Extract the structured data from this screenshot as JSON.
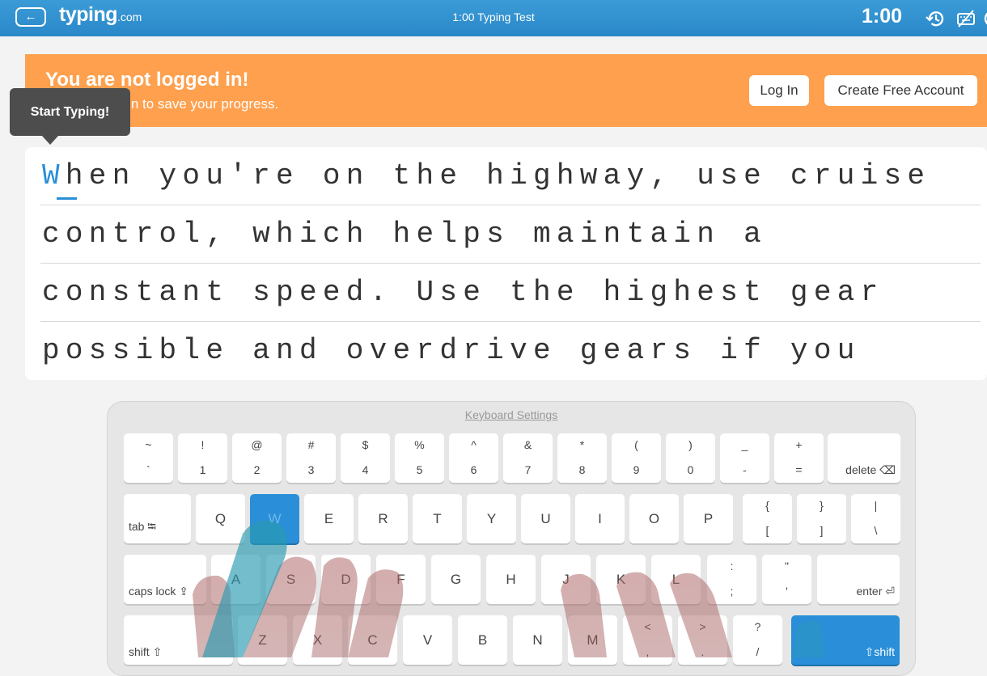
{
  "header": {
    "back_icon": "arrow-left-icon",
    "logo_main": "typing",
    "logo_domain": ".com",
    "title": "1:00 Typing Test",
    "timer": "1:00",
    "history_icon": "history-icon",
    "hide_keyboard_icon": "keyboard-off-icon",
    "colors": {
      "bar": "#2a88c9",
      "accent": "#2a8fd8"
    }
  },
  "banner": {
    "title": "You are not logged in!",
    "subtitle": "ccount or log in to save your progress.",
    "login_label": "Log In",
    "create_label": "Create Free Account",
    "color": "#fea04e"
  },
  "tooltip": {
    "text": "Start Typing!"
  },
  "text_panel": {
    "current_char": "W",
    "line1_rest": "hen you're on the highway, use cruise",
    "lines": [
      "control, which helps maintain a",
      "constant speed. Use the highest gear",
      "possible and overdrive gears if you"
    ]
  },
  "keyboard": {
    "settings_label": "Keyboard Settings",
    "row1": [
      {
        "top": "~",
        "bottom": "`"
      },
      {
        "top": "!",
        "bottom": "1"
      },
      {
        "top": "@",
        "bottom": "2"
      },
      {
        "top": "#",
        "bottom": "3"
      },
      {
        "top": "$",
        "bottom": "4"
      },
      {
        "top": "%",
        "bottom": "5"
      },
      {
        "top": "^",
        "bottom": "6"
      },
      {
        "top": "&",
        "bottom": "7"
      },
      {
        "top": "*",
        "bottom": "8"
      },
      {
        "top": "(",
        "bottom": "9"
      },
      {
        "top": ")",
        "bottom": "0"
      },
      {
        "top": "_",
        "bottom": "-"
      },
      {
        "top": "+",
        "bottom": "="
      }
    ],
    "delete_label": "delete ⌫",
    "tab_label": "tab ⭾",
    "row2": [
      "Q",
      "W",
      "E",
      "R",
      "T",
      "Y",
      "U",
      "I",
      "O",
      "P"
    ],
    "row2_symbols": [
      {
        "top": "{",
        "bottom": "["
      },
      {
        "top": "}",
        "bottom": "]"
      },
      {
        "top": "|",
        "bottom": "\\"
      }
    ],
    "caps_label": "caps lock ⇪",
    "row3": [
      "A",
      "S",
      "D",
      "F",
      "G",
      "H",
      "J",
      "K",
      "L"
    ],
    "row3_symbols": [
      {
        "top": ":",
        "bottom": ";"
      },
      {
        "top": "\"",
        "bottom": "'"
      }
    ],
    "enter_label": "enter ⏎",
    "shift_left_label": "shift ⇧",
    "row4": [
      "Z",
      "X",
      "C",
      "V",
      "B",
      "N",
      "M"
    ],
    "row4_symbols": [
      {
        "top": "<",
        "bottom": ","
      },
      {
        "top": ">",
        "bottom": "."
      },
      {
        "top": "?",
        "bottom": "/"
      }
    ],
    "shift_right_label": "⇧shift",
    "active_key": "W"
  }
}
